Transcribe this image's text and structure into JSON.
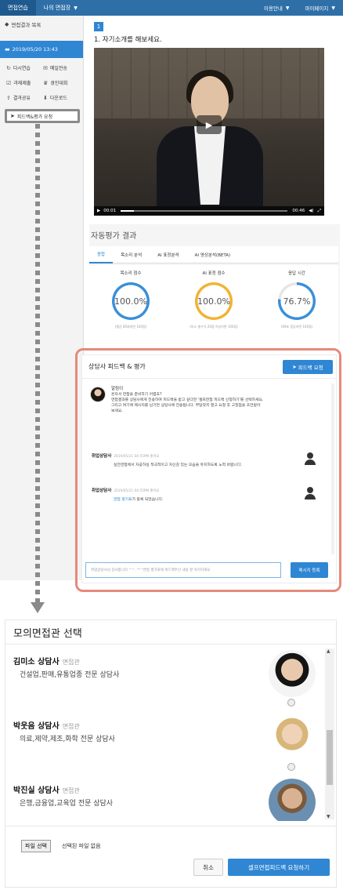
{
  "topbar": {
    "tabs": [
      {
        "label": "면접연습"
      },
      {
        "label": "나의 면접장",
        "caret": "▼"
      }
    ],
    "right": [
      {
        "label": "이용안내",
        "caret": "▼"
      },
      {
        "label": "마이페이지",
        "caret": "▼"
      }
    ]
  },
  "sidebar": {
    "back_label": "면접결과 목록",
    "back_icon": "back-arrow-icon",
    "date_label": "2019/05/20 13:43",
    "actions": [
      {
        "label": "다시연습",
        "icon": "refresh-icon"
      },
      {
        "label": "메일전송",
        "icon": "mail-icon"
      },
      {
        "label": "과제제출",
        "icon": "submit-icon"
      },
      {
        "label": "경진대회",
        "icon": "trophy-icon"
      },
      {
        "label": "결과공유",
        "icon": "share-icon"
      },
      {
        "label": "다운로드",
        "icon": "download-icon"
      }
    ],
    "feedback_request_label": "피드백&평가 요청"
  },
  "question": {
    "number": "1",
    "text": "1. 자기소개를 해보세요."
  },
  "video": {
    "current_time": "00:01",
    "duration": "00:46",
    "progress": 0.08
  },
  "auto_eval": {
    "title": "자동평가 결과",
    "tabs": [
      "종합",
      "목소리 분석",
      "AI 표정분석",
      "AI 영상분석(BETA)"
    ],
    "active_tab": 0,
    "gauges": [
      {
        "label": "목소리 점수",
        "value": "100.0%",
        "percent": 100,
        "color": "#3a8fd8",
        "note": "(평균 85회미만 100점)"
      },
      {
        "label": "AI 표정 점수",
        "value": "100.0%",
        "percent": 100,
        "color": "#f2b233",
        "note": "(미소 총수가 20점 이상이면 100점)"
      },
      {
        "label": "응답 시간",
        "value": "76.7%",
        "percent": 76.7,
        "color": "#3a8fd8",
        "note": "(60초 응답하면 100점)"
      }
    ]
  },
  "feedback": {
    "title": "상담사 피드백 & 평가",
    "request_btn": "피드백 요청",
    "notice": {
      "who": "알림이",
      "lines": [
        "혼자서 면접을 준비하기 어렵죠?",
        "면접결과를 상담사에게 전송하여 피드백을 받고 싶다면 '셀프면접 피드백 신청하기'를 선택하세요.",
        "그리고 여기에 메시지를 남기면 상담사에 전송됩니다. 부담갖지 말고 요청 후 고칠점을 조언받아",
        "보세요."
      ]
    },
    "messages": [
      {
        "who": "취업상담사",
        "time": "2019/05/21 04:55PM 좋아요",
        "body": "실전면접에서 자공하실 적극적이고 자신감 있는 모습을 유지하도록 노력 바랍니다."
      },
      {
        "who": "취업상담사",
        "time": "2019/05/21 04:55PM 좋아요",
        "link": "면접 평가표",
        "body": "가 등록 되었습니다."
      }
    ],
    "input_placeholder": "취업상담사님 감사합니다 ^^..\"* \"면접 평가표에 피드백주신 내용 잘 숙지하세요",
    "send_btn": "메시지 등록"
  },
  "selector": {
    "title": "모의면접관 선택",
    "counselors": [
      {
        "name": "김미소 상담사",
        "tag": "면접관",
        "spec": "건설업,판매,유통업종 전문 상담사",
        "photo": "counselor-photo-1"
      },
      {
        "name": "박웃음 상담사",
        "tag": "면접관",
        "spec": "의료,제약,제조,화학 전문 상담사",
        "photo": "counselor-photo-2"
      },
      {
        "name": "박진실 상담사",
        "tag": "면접관",
        "spec": "은행,금융업,교육업 전문 상담사",
        "photo": "counselor-photo-3"
      }
    ],
    "file_btn": "파일 선택",
    "file_status": "선택된 파일 없음",
    "cancel_btn": "취소",
    "submit_btn": "셀프면접피드백 요청하기"
  }
}
